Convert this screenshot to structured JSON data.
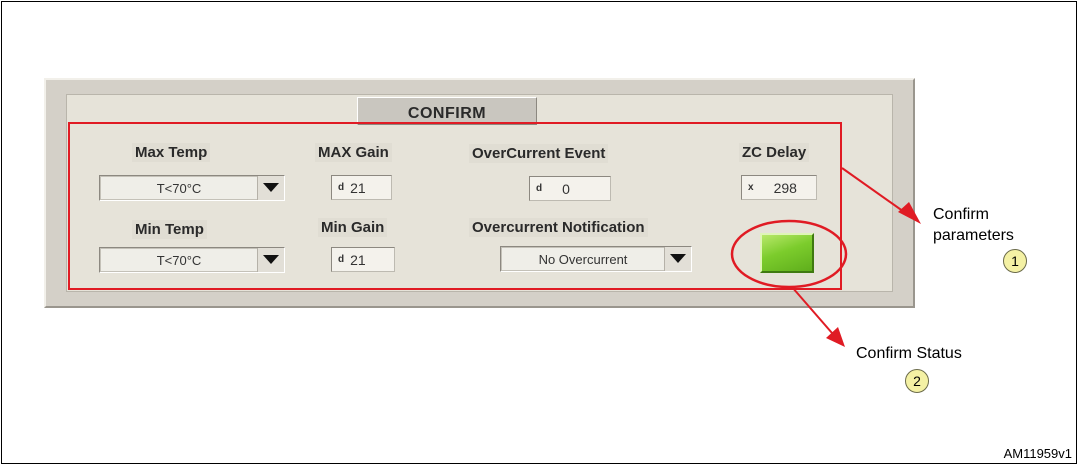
{
  "panel": {
    "title": "CONFIRM",
    "max_temp": {
      "label": "Max Temp",
      "value": "T<70°C"
    },
    "min_temp": {
      "label": "Min Temp",
      "value": "T<70°C"
    },
    "max_gain": {
      "label": "MAX Gain",
      "radix": "d",
      "value": "21"
    },
    "min_gain": {
      "label": "Min Gain",
      "radix": "d",
      "value": "21"
    },
    "overcurrent_event": {
      "label": "OverCurrent Event",
      "radix": "d",
      "value": "0"
    },
    "overcurrent_notification": {
      "label": "Overcurrent Notification",
      "value": "No Overcurrent"
    },
    "zc_delay": {
      "label": "ZC Delay",
      "radix": "x",
      "value": "298"
    },
    "status_led_color": "#7ccc2c"
  },
  "annotations": {
    "confirm_parameters": {
      "line1": "Confirm",
      "line2": "parameters",
      "number": "1"
    },
    "confirm_status": {
      "text": "Confirm Status",
      "number": "2"
    },
    "highlight_color": "#e01b24"
  },
  "figure_id": "AM11959v1"
}
